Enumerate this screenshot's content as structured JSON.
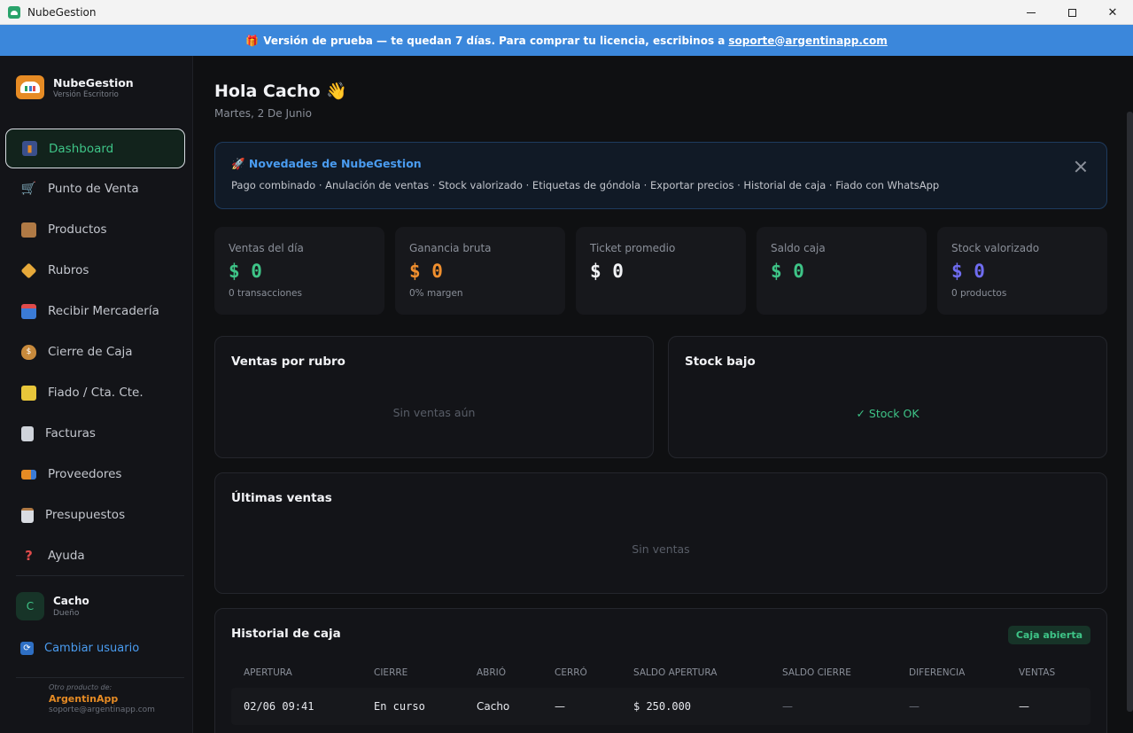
{
  "window": {
    "title": "NubeGestion"
  },
  "banner": {
    "text": "Versión de prueba — te quedan 7 días. Para comprar tu licencia, escribinos a",
    "email": "soporte@argentinapp.com"
  },
  "brand": {
    "name": "NubeGestion",
    "subtitle": "Versión Escritorio"
  },
  "sidebar": {
    "items": [
      {
        "label": "Dashboard",
        "icon": "bar-chart-icon",
        "active": true
      },
      {
        "label": "Punto de Venta",
        "icon": "cart-icon"
      },
      {
        "label": "Productos",
        "icon": "package-icon"
      },
      {
        "label": "Rubros",
        "icon": "tag-icon"
      },
      {
        "label": "Recibir Mercadería",
        "icon": "inbox-icon"
      },
      {
        "label": "Cierre de Caja",
        "icon": "money-bag-icon"
      },
      {
        "label": "Fiado / Cta. Cte.",
        "icon": "ledger-icon"
      },
      {
        "label": "Facturas",
        "icon": "receipt-icon"
      },
      {
        "label": "Proveedores",
        "icon": "truck-icon"
      },
      {
        "label": "Presupuestos",
        "icon": "clipboard-icon"
      },
      {
        "label": "Ayuda",
        "icon": "question-icon"
      }
    ]
  },
  "user": {
    "initial": "C",
    "name": "Cacho",
    "role": "Dueño",
    "switch_label": "Cambiar usuario"
  },
  "footer": {
    "tagline": "Otro producto de:",
    "company": "ArgentinApp",
    "email": "soporte@argentinapp.com"
  },
  "main": {
    "greeting": "Hola Cacho 👋",
    "date": "Martes, 2 De Junio",
    "news": {
      "title": "🚀 Novedades de NubeGestion",
      "body": "Pago combinado · Anulación de ventas · Stock valorizado · Etiquetas de góndola · Exportar precios · Historial de caja · Fiado con WhatsApp"
    },
    "stats": [
      {
        "label": "Ventas del día",
        "value": "$ 0",
        "sub": "0 transacciones",
        "color": "#3ec487"
      },
      {
        "label": "Ganancia bruta",
        "value": "$ 0",
        "sub": "0% margen",
        "color": "#f08f2e"
      },
      {
        "label": "Ticket promedio",
        "value": "$ 0",
        "sub": "",
        "color": "#f1f2f5"
      },
      {
        "label": "Saldo caja",
        "value": "$ 0",
        "sub": "",
        "color": "#3ec487"
      },
      {
        "label": "Stock valorizado",
        "value": "$ 0",
        "sub": "0 productos",
        "color": "#6f6cf0"
      }
    ],
    "ventas_rubro": {
      "title": "Ventas por rubro",
      "empty": "Sin ventas aún"
    },
    "stock_bajo": {
      "title": "Stock bajo",
      "empty": "✓ Stock OK"
    },
    "ultimas_ventas": {
      "title": "Últimas ventas",
      "empty": "Sin ventas"
    },
    "historial": {
      "title": "Historial de caja",
      "badge": "Caja abierta",
      "columns": [
        "APERTURA",
        "CIERRE",
        "ABRIÓ",
        "CERRÓ",
        "SALDO APERTURA",
        "SALDO CIERRE",
        "DIFERENCIA",
        "VENTAS"
      ],
      "rows": [
        {
          "apertura": "02/06 09:41",
          "cierre": "En curso",
          "abrio": "Cacho",
          "cerro": "—",
          "saldo_apertura": "$ 250.000",
          "saldo_cierre": "—",
          "diferencia": "—",
          "ventas": "—"
        }
      ]
    }
  }
}
